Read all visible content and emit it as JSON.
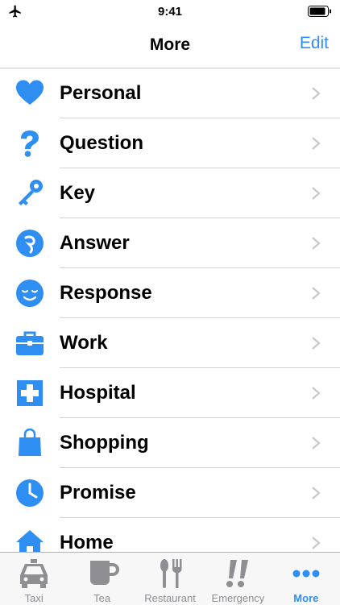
{
  "status_bar": {
    "time": "9:41"
  },
  "nav": {
    "title": "More",
    "edit_label": "Edit"
  },
  "colors": {
    "accent": "#2f8ef2",
    "inactive": "#8e8e93",
    "chevron": "#c7c7cc"
  },
  "list": {
    "items": [
      {
        "label": "Personal",
        "icon": "heart-icon"
      },
      {
        "label": "Question",
        "icon": "question-icon"
      },
      {
        "label": "Key",
        "icon": "key-icon"
      },
      {
        "label": "Answer",
        "icon": "answer-icon"
      },
      {
        "label": "Response",
        "icon": "smiley-icon"
      },
      {
        "label": "Work",
        "icon": "briefcase-icon"
      },
      {
        "label": "Hospital",
        "icon": "hospital-cross-icon"
      },
      {
        "label": "Shopping",
        "icon": "shopping-bag-icon"
      },
      {
        "label": "Promise",
        "icon": "clock-icon"
      },
      {
        "label": "Home",
        "icon": "house-icon"
      }
    ]
  },
  "tabs": [
    {
      "label": "Taxi",
      "icon": "taxi-icon",
      "active": false
    },
    {
      "label": "Tea",
      "icon": "teacup-icon",
      "active": false
    },
    {
      "label": "Restaurant",
      "icon": "fork-spoon-icon",
      "active": false
    },
    {
      "label": "Emergency",
      "icon": "exclamation-icon",
      "active": false
    },
    {
      "label": "More",
      "icon": "more-dots-icon",
      "active": true
    }
  ]
}
